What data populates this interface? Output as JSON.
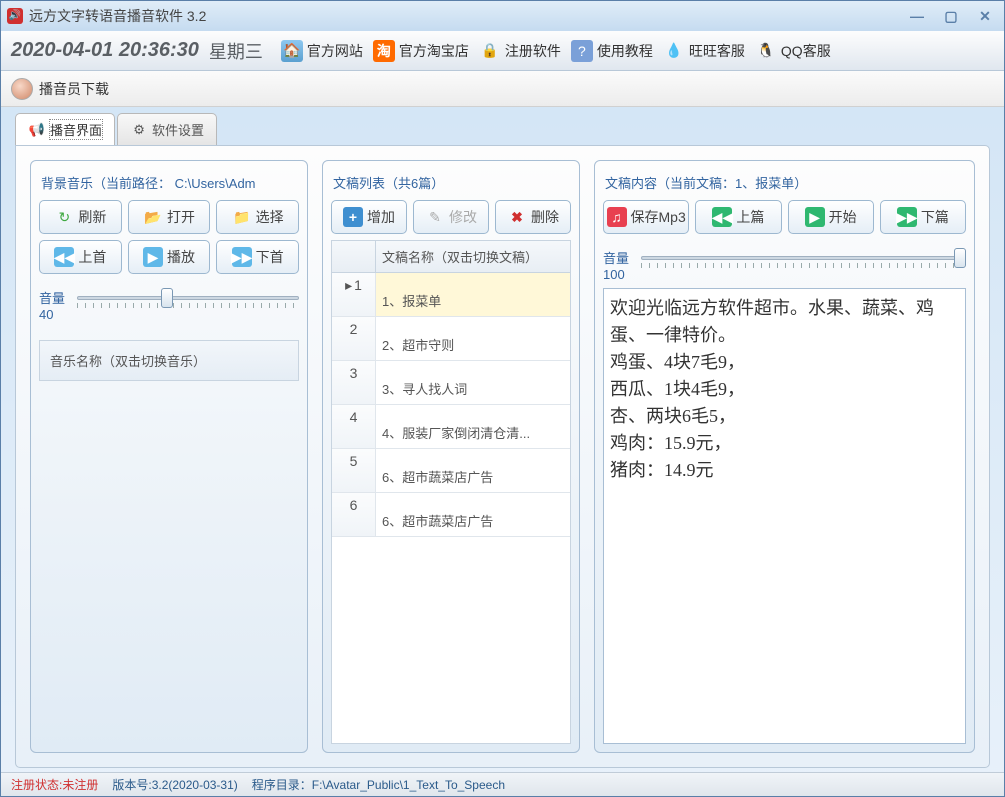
{
  "window": {
    "title": "远方文字转语音播音软件 3.2"
  },
  "toolbar": {
    "datetime": "2020-04-01 20:36:30",
    "weekday": "星期三",
    "links": {
      "site": "官方网站",
      "taobao": "官方淘宝店",
      "tao_badge": "淘",
      "register": "注册软件",
      "tutorial": "使用教程",
      "wangwang": "旺旺客服",
      "qq": "QQ客服"
    }
  },
  "subbar": {
    "download": "播音员下载"
  },
  "tabs": {
    "broadcast": "播音界面",
    "settings": "软件设置"
  },
  "left": {
    "title": "背景音乐（当前路径：  C:\\Users\\Adm",
    "btns": {
      "refresh": "刷新",
      "open": "打开",
      "choose": "选择",
      "prev": "上首",
      "play": "播放",
      "next": "下首"
    },
    "vol_label": "音量",
    "vol_value": "40",
    "music_header": "音乐名称（双击切换音乐）"
  },
  "mid": {
    "title": "文稿列表（共6篇）",
    "btns": {
      "add": "增加",
      "edit": "修改",
      "del": "删除"
    },
    "col_header": "文稿名称（双击切换文稿）",
    "rows": [
      {
        "idx": "1",
        "name": "1、报菜单"
      },
      {
        "idx": "2",
        "name": "2、超市守则"
      },
      {
        "idx": "3",
        "name": "3、寻人找人词"
      },
      {
        "idx": "4",
        "name": "4、服装厂家倒闭清仓清..."
      },
      {
        "idx": "5",
        "name": "6、超市蔬菜店广告"
      },
      {
        "idx": "6",
        "name": "6、超市蔬菜店广告"
      }
    ]
  },
  "right": {
    "title": "文稿内容（当前文稿：1、报菜单）",
    "btns": {
      "mp3": "保存Mp3",
      "prev": "上篇",
      "play": "开始",
      "next": "下篇"
    },
    "vol_label": "音量",
    "vol_value": "100",
    "content": "欢迎光临远方软件超市。水果、蔬菜、鸡蛋、一律特价。\n鸡蛋、4块7毛9，\n西瓜、1块4毛9，\n杏、两块6毛5，\n鸡肉：15.9元，\n猪肉：14.9元"
  },
  "status": {
    "reg_label": "注册状态:",
    "reg_value": "未注册",
    "version": "版本号:3.2(2020-03-31)",
    "dir": "程序目录：F:\\Avatar_Public\\1_Text_To_Speech"
  }
}
